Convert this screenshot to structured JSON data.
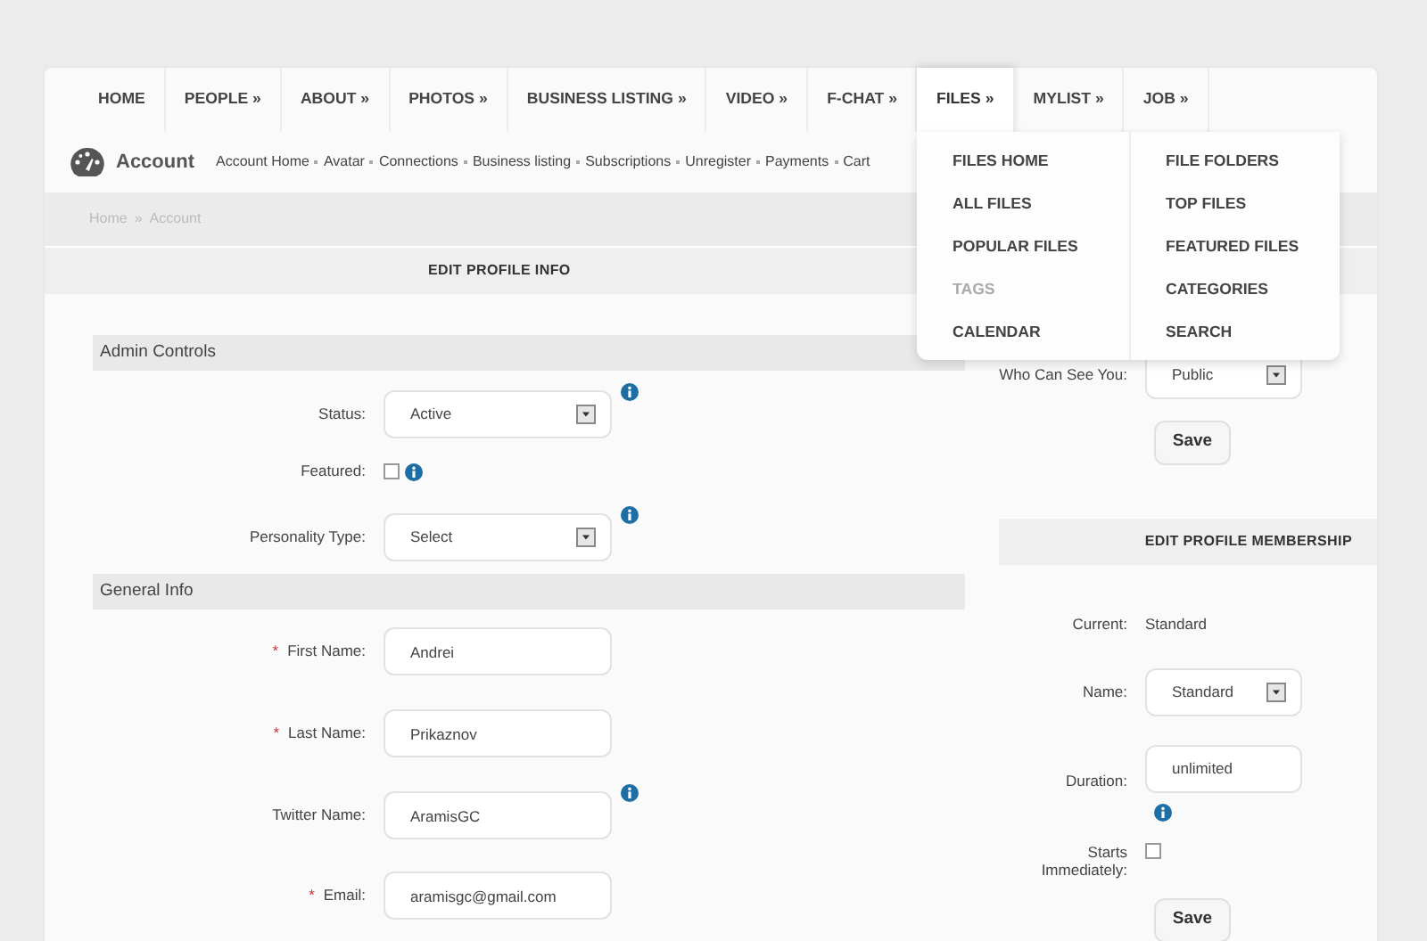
{
  "nav": [
    {
      "label": "HOME",
      "expanded": false
    },
    {
      "label": "PEOPLE »",
      "expanded": false
    },
    {
      "label": "ABOUT »",
      "expanded": false
    },
    {
      "label": "PHOTOS »",
      "expanded": false
    },
    {
      "label": "BUSINESS LISTING »",
      "expanded": false
    },
    {
      "label": "VIDEO »",
      "expanded": false
    },
    {
      "label": "F-CHAT »",
      "expanded": false
    },
    {
      "label": "FILES »",
      "expanded": true,
      "submenu": [
        [
          {
            "label": "FILES HOME",
            "disabled": false
          },
          {
            "label": "ALL FILES",
            "disabled": false
          },
          {
            "label": "POPULAR FILES",
            "disabled": false
          },
          {
            "label": "TAGS",
            "disabled": true
          },
          {
            "label": "CALENDAR",
            "disabled": false
          }
        ],
        [
          {
            "label": "FILE FOLDERS",
            "disabled": false
          },
          {
            "label": "TOP FILES",
            "disabled": false
          },
          {
            "label": "FEATURED FILES",
            "disabled": false
          },
          {
            "label": "CATEGORIES",
            "disabled": false
          },
          {
            "label": "SEARCH",
            "disabled": false
          }
        ]
      ]
    },
    {
      "label": "MYLIST »",
      "expanded": false
    },
    {
      "label": "JOB »",
      "expanded": false
    }
  ],
  "account": {
    "title": "Account",
    "links": [
      "Account Home",
      "Avatar",
      "Connections",
      "Business listing",
      "Subscriptions",
      "Unregister",
      "Payments",
      "Cart"
    ]
  },
  "breadcrumb": {
    "items": [
      "Home",
      "Account"
    ],
    "separator": "»"
  },
  "profile_info": {
    "title": "EDIT PROFILE INFO",
    "sections": [
      {
        "title": "Admin Controls",
        "fields": [
          {
            "kind": "select",
            "label": "Status:",
            "value": "Active",
            "info": true
          },
          {
            "kind": "checkbox",
            "label": "Featured:",
            "checked": false,
            "info": true
          },
          {
            "kind": "select",
            "label": "Personality Type:",
            "value": "Select",
            "info": true
          }
        ]
      },
      {
        "title": "General Info",
        "fields": [
          {
            "kind": "input",
            "label": "First Name:",
            "required_mark": "*",
            "value": "Andrei",
            "info": false
          },
          {
            "kind": "input",
            "label": "Last Name:",
            "required_mark": "*",
            "value": "Prikaznov",
            "info": false
          },
          {
            "kind": "input",
            "label": "Twitter Name:",
            "value": "AramisGC",
            "info": true
          },
          {
            "kind": "input",
            "label": "Email:",
            "required_mark": "*",
            "value": "aramisgc@gmail.com",
            "info": false
          }
        ]
      }
    ]
  },
  "privacy": {
    "fields": [
      {
        "kind": "select",
        "label": "Who Can See You:",
        "value": "Public",
        "info": false
      }
    ],
    "button": "Save"
  },
  "membership": {
    "title": "EDIT PROFILE MEMBERSHIP",
    "fields": [
      {
        "kind": "text",
        "label": "Current:",
        "value": "Standard"
      },
      {
        "kind": "select",
        "label": "Name:",
        "value": "Standard",
        "info": false
      },
      {
        "kind": "input",
        "label": "Duration:",
        "value": "unlimited",
        "info": true
      },
      {
        "kind": "checkbox",
        "label": "Starts Immediately:",
        "checked": false,
        "info": false
      }
    ],
    "button": "Save"
  }
}
